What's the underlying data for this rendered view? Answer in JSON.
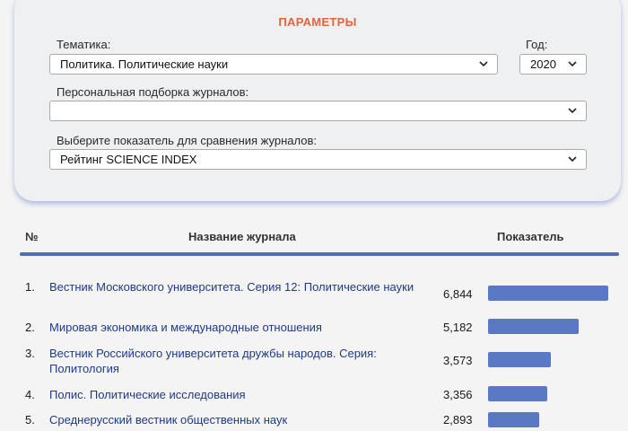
{
  "params": {
    "title": "ПАРАМЕТРЫ",
    "topic_label": "Тематика:",
    "topic_value": "Политика. Политические науки",
    "year_label": "Год:",
    "year_value": "2020",
    "journals_label": "Персональная подборка журналов:",
    "journals_value": "",
    "indicator_label": "Выберите показатель для сравнения журналов:",
    "indicator_value": "Рейтинг SCIENCE INDEX"
  },
  "table": {
    "headers": {
      "num": "№",
      "name": "Название журнала",
      "value": "Показатель"
    },
    "rows": [
      {
        "num": "1.",
        "name": "Вестник Московского университета. Серия 12: Политические науки",
        "value": "6,844",
        "score": 6.844
      },
      {
        "num": "2.",
        "name": "Мировая экономика и международные отношения",
        "value": "5,182",
        "score": 5.182
      },
      {
        "num": "3.",
        "name": "Вестник Российского университета дружбы народов. Серия: Политология",
        "value": "3,573",
        "score": 3.573
      },
      {
        "num": "4.",
        "name": "Полис. Политические исследования",
        "value": "3,356",
        "score": 3.356
      },
      {
        "num": "5.",
        "name": "Среднерусский вестник общественных наук",
        "value": "2,893",
        "score": 2.893
      }
    ]
  },
  "colors": {
    "accent": "#4f6cb7",
    "bar": "#5b78c4",
    "title": "#e0663c",
    "link": "#1f3a88"
  },
  "icons": {
    "dropdown": "chevron-down-icon"
  }
}
